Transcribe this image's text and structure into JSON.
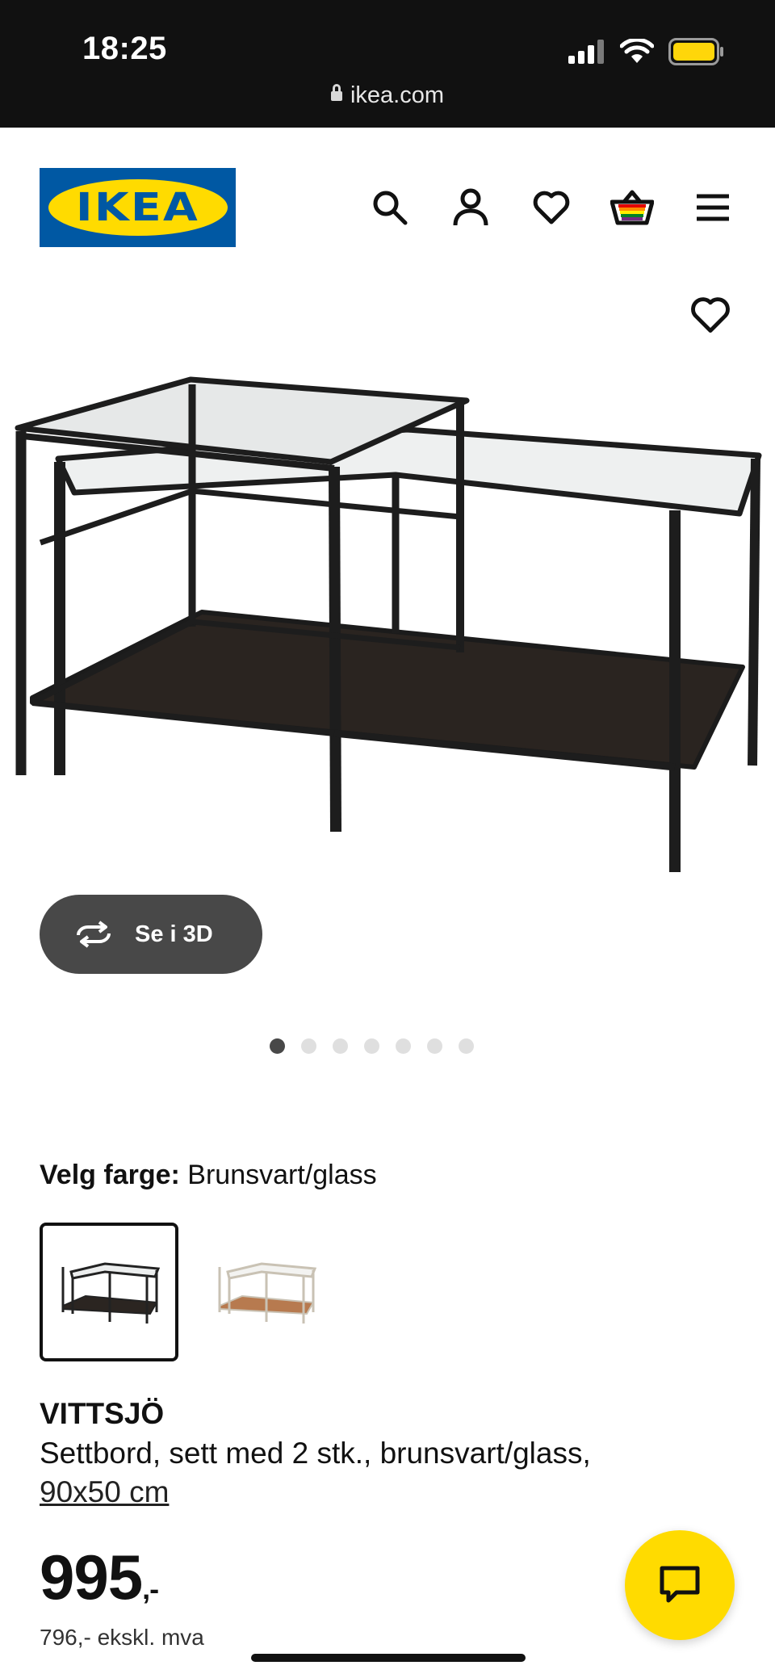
{
  "status_bar": {
    "time": "18:25",
    "url": "ikea.com",
    "icons": [
      "signal-icon",
      "wifi-icon",
      "battery-icon"
    ]
  },
  "header": {
    "logo_text": "IKEA",
    "nav_icons": [
      "search-icon",
      "account-icon",
      "heart-icon",
      "basket-icon",
      "menu-icon"
    ],
    "colors": {
      "logo_blue": "#0058a3",
      "logo_yellow": "#ffdb00"
    }
  },
  "gallery": {
    "view_3d_label": "Se i 3D",
    "dot_count": 7,
    "active_dot": 0
  },
  "color_select": {
    "label": "Velg farge:",
    "selected_value": "Brunsvart/glass",
    "options": [
      "brunsvart-glass",
      "hvit-glass"
    ]
  },
  "product": {
    "name": "VITTSJÖ",
    "description": "Settbord, sett med 2 stk., brunsvart/glass,",
    "size": "90x50 cm",
    "price": "995",
    "price_suffix": ",-",
    "price_ex_vat": "796,- ekskl. mva"
  },
  "chat": {
    "icon": "chat-icon",
    "color": "#ffdb00"
  }
}
